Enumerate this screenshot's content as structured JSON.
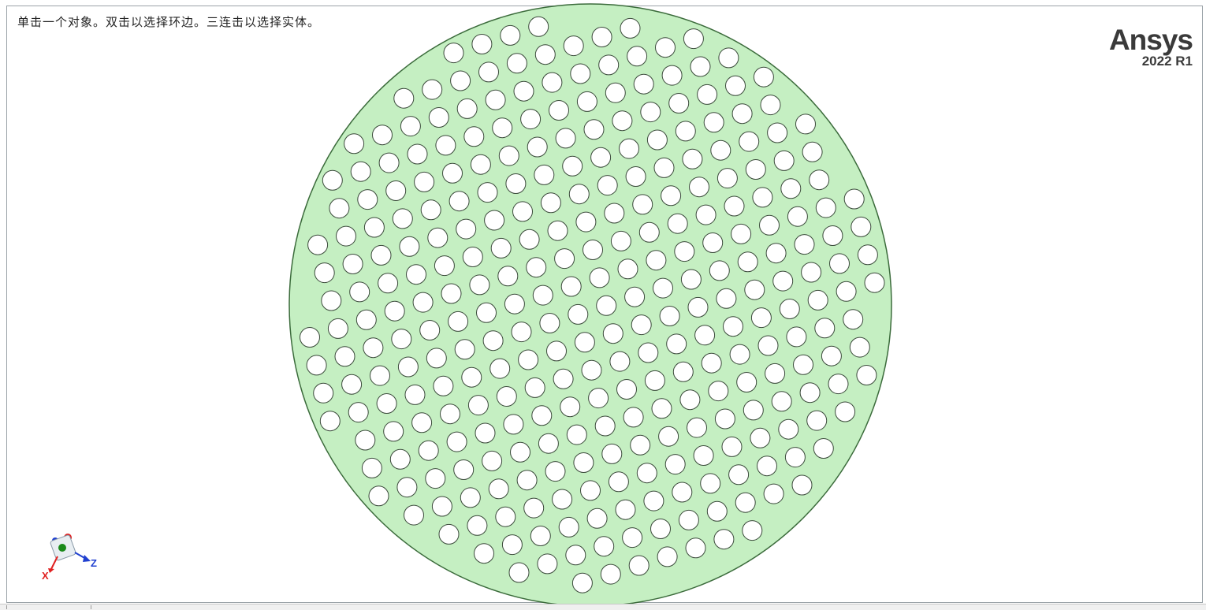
{
  "viewport": {
    "hint_text": "单击一个对象。双击以选择环边。三连击以选择实体。",
    "logo_brand": "Ansys",
    "logo_version": "2022 R1"
  },
  "model": {
    "part_color": "#c5efc2",
    "edge_color": "#3b6b3b",
    "hole_color": "#ffffff"
  },
  "triad": {
    "x_label": "X",
    "z_label": "Z",
    "x_color": "#e02020",
    "z_color": "#2040d0",
    "origin_color": "#1a8a1a"
  }
}
